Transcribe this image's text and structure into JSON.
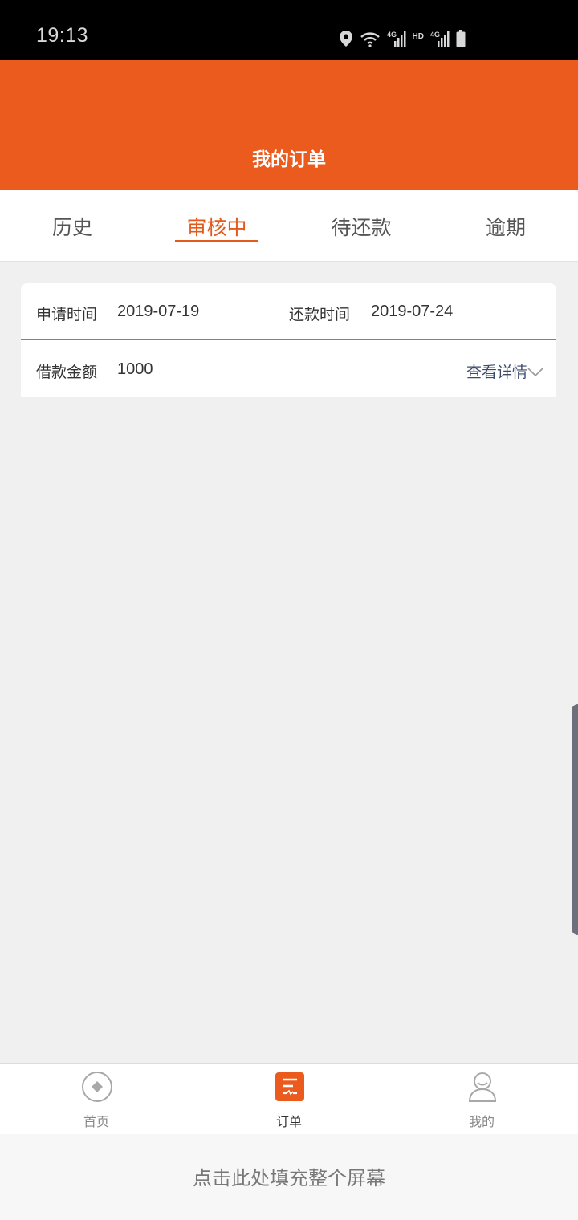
{
  "status_bar": {
    "time": "19:13",
    "icons": [
      "location-icon",
      "wifi-icon",
      "4g-signal-icon",
      "hd-icon",
      "4g-signal-icon",
      "battery-icon"
    ],
    "hd_label": "HD"
  },
  "header": {
    "title": "我的订单",
    "color": "#eb5b1e"
  },
  "tabs": [
    {
      "label": "历史",
      "active": false
    },
    {
      "label": "审核中",
      "active": true
    },
    {
      "label": "待还款",
      "active": false
    },
    {
      "label": "逾期",
      "active": false
    }
  ],
  "order": {
    "apply_time_label": "申请时间",
    "apply_time": "2019-07-19",
    "repay_time_label": "还款时间",
    "repay_time": "2019-07-24",
    "amount_label": "借款金额",
    "amount": "1000",
    "detail_link": "查看详情"
  },
  "bottom_nav": [
    {
      "label": "首页",
      "icon": "home-icon",
      "active": false
    },
    {
      "label": "订单",
      "icon": "order-list-icon",
      "active": true
    },
    {
      "label": "我的",
      "icon": "profile-icon",
      "active": false
    }
  ],
  "fill_screen_text": "点击此处填充整个屏幕",
  "accent_color": "#e35a1c"
}
